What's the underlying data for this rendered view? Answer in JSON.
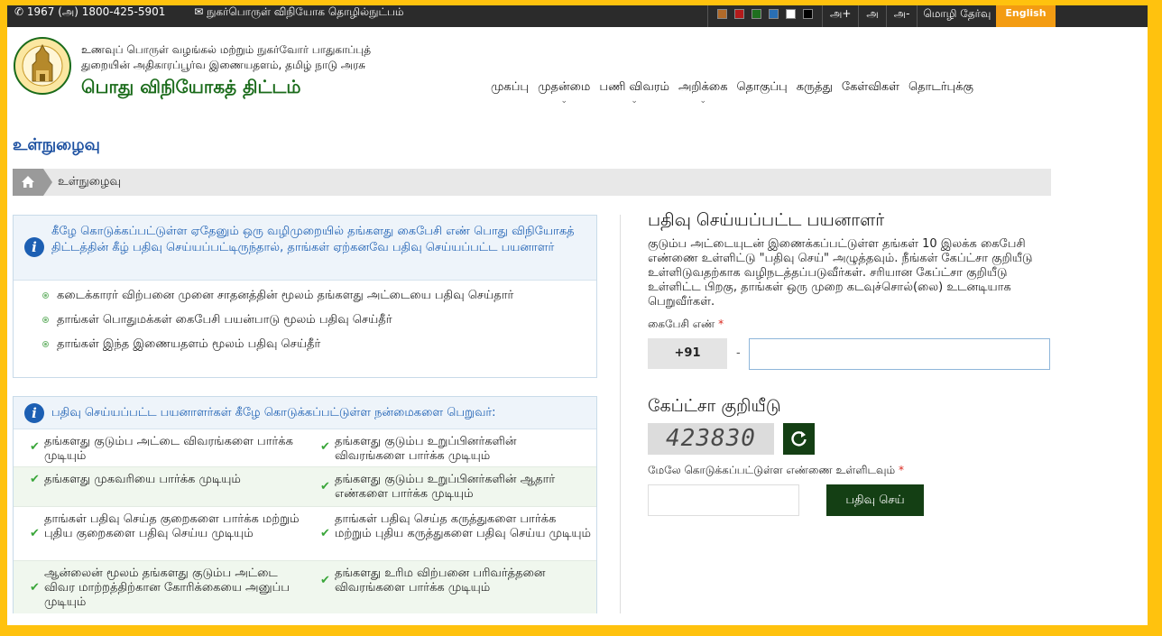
{
  "topbar": {
    "phone": "1967 (அ) 1800-425-5901",
    "email": "நுகர்பொருள் விநியோக தொழில்நுட்பம்",
    "swatches": [
      "#b06a2a",
      "#b31b1b",
      "#1f6f1f",
      "#2a6fb3",
      "#ffffff",
      "#000000"
    ],
    "font_plus": "அ+",
    "font_normal": "அ",
    "font_minus": "அ-",
    "lang_label": "மொழி தேர்வு",
    "english": "English"
  },
  "header": {
    "dept_line1": "உணவுப் பொருள் வழங்கல் மற்றும் நுகர்வோர் பாதுகாப்புத்",
    "dept_line2": "துறையின் அதிகாரப்பூர்வ இணையதளம், தமிழ் நாடு அரசு",
    "scheme": "பொது விநியோகத் திட்டம்"
  },
  "nav": [
    "முகப்பு",
    "முதன்மை",
    "பணி விவரம்",
    "அறிக்கை",
    "தொகுப்பு",
    "கருத்து",
    "கேள்விகள்",
    "தொடர்புக்கு"
  ],
  "page": {
    "title": "உள்நுழைவு",
    "breadcrumb": "உள்நுழைவு"
  },
  "info1": {
    "heading": "கீழே கொடுக்கப்பட்டுள்ள ஏதேனும் ஒரு வழிமுறையில் தங்களது கைபேசி எண் பொது விநியோகத் திட்டத்தின் கீழ் பதிவு செய்யப்பட்டிருந்தால், தாங்கள் ஏற்கனவே பதிவு செய்யப்பட்ட பயனாளர்",
    "items": [
      "கடைக்காரர் விற்பனை முனை சாதனத்தின் மூலம் தங்களது அட்டையை பதிவு செய்தார்",
      "தாங்கள் பொதுமக்கள் கைபேசி பயன்பாடு மூலம் பதிவு செய்தீர்",
      "தாங்கள் இந்த இணையதளம் மூலம் பதிவு செய்தீர்"
    ]
  },
  "info2": {
    "heading": "பதிவு செய்யப்பட்ட பயனாளர்கள் கீழே கொடுக்கப்பட்டுள்ள நன்மைகளை பெறுவர்:",
    "benefits": [
      [
        "தங்களது குடும்ப அட்டை விவரங்களை பார்க்க முடியும்",
        "தங்களது குடும்ப உறுப்பினர்களின் விவரங்களை பார்க்க முடியும்"
      ],
      [
        "தங்களது முகவரியை பார்க்க முடியும்",
        "தங்களது குடும்ப உறுப்பினர்களின் ஆதார் எண்களை பார்க்க முடியும்"
      ],
      [
        "தாங்கள் பதிவு செய்த குறைகளை பார்க்க மற்றும் புதிய குறைகளை பதிவு செய்ய முடியும்",
        "தாங்கள் பதிவு செய்த கருத்துகளை பார்க்க மற்றும் புதிய கருத்துகளை பதிவு செய்ய முடியும்"
      ],
      [
        "ஆன்லைன் மூலம் தங்களது குடும்ப அட்டை விவர மாற்றத்திற்கான கோரிக்கையை அனுப்ப முடியும்",
        "தங்களது உரிம விற்பனை பரிவர்த்தனை விவரங்களை பார்க்க முடியும்"
      ]
    ]
  },
  "login": {
    "title": "பதிவு செய்யப்பட்ட பயனாளர்",
    "description": "குடும்ப அட்டையுடன் இணைக்கப்பட்டுள்ள தங்கள் 10 இலக்க கைபேசி எண்ணை உள்ளிட்டு \"பதிவு செய்\" அழுத்தவும். நீங்கள் கேப்ட்சா குறியீடு உள்ளிடுவதற்காக வழிநடத்தப்படுவீர்கள். சரியான கேப்ட்சா குறியீடு உள்ளிட்ட பிறகு, தாங்கள் ஒரு முறை கடவுச்சொல்(லை) உடனடியாக பெறுவீர்கள்.",
    "mobile_label": "கைபேசி எண்",
    "required_mark": "*",
    "country_code": "+91",
    "separator": "-",
    "mobile_value": "",
    "captcha_title": "கேப்ட்சா குறியீடு",
    "captcha_text": "423830",
    "captcha_label": "மேலே கொடுக்கப்பட்டுள்ள எண்ணை உள்ளிடவும்",
    "captcha_value": "",
    "submit": "பதிவு செய்"
  }
}
